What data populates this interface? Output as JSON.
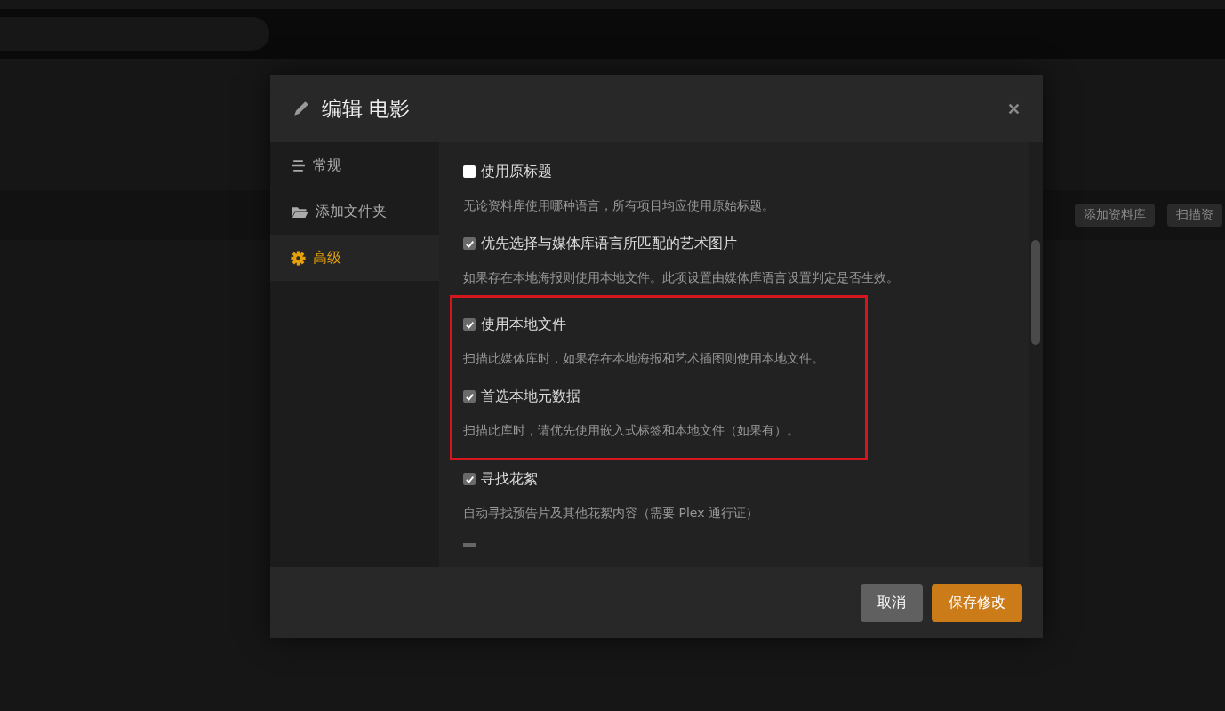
{
  "page": {
    "toolbar_buttons": [
      "添加资料库",
      "扫描资"
    ]
  },
  "dialog": {
    "title": "编辑 电影",
    "sidebar": {
      "items": [
        {
          "label": "常规",
          "selected": false
        },
        {
          "label": "添加文件夹",
          "selected": false
        },
        {
          "label": "高级",
          "selected": true
        }
      ]
    },
    "option_groups": [
      {
        "highlighted": false,
        "options": [
          {
            "label": "使用原标题",
            "checked": false,
            "description": "无论资料库使用哪种语言，所有项目均应使用原始标题。"
          },
          {
            "label": "优先选择与媒体库语言所匹配的艺术图片",
            "checked": true,
            "description": "如果存在本地海报则使用本地文件。此项设置由媒体库语言设置判定是否生效。"
          }
        ]
      },
      {
        "highlighted": true,
        "options": [
          {
            "label": "使用本地文件",
            "checked": true,
            "description": "扫描此媒体库时，如果存在本地海报和艺术插图则使用本地文件。"
          },
          {
            "label": "首选本地元数据",
            "checked": true,
            "description": "扫描此库时，请优先使用嵌入式标签和本地文件（如果有）。"
          }
        ]
      },
      {
        "highlighted": false,
        "options": [
          {
            "label": "寻找花絮",
            "checked": true,
            "description": "自动寻找预告片及其他花絮内容（需要 Plex 通行证）"
          }
        ]
      }
    ],
    "buttons": [
      {
        "label": "取消",
        "kind": "secondary"
      },
      {
        "label": "保存修改",
        "kind": "primary"
      }
    ]
  }
}
